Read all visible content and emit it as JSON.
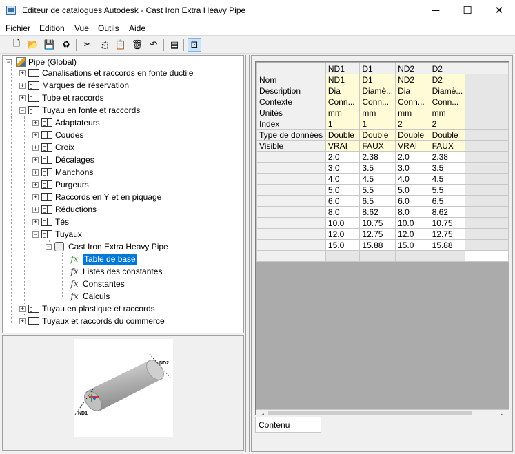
{
  "window": {
    "title": "Editeur de catalogues Autodesk - Cast Iron Extra Heavy Pipe",
    "minimize": "─",
    "maximize": "☐",
    "close": "✕"
  },
  "menu": [
    {
      "label": "Fichier"
    },
    {
      "label": "Edition"
    },
    {
      "label": "Vue"
    },
    {
      "label": "Outils"
    },
    {
      "label": "Aide"
    }
  ],
  "toolbar": {
    "icons": [
      "new-file-icon",
      "open-folder-icon",
      "save-icon",
      "recycle-icon",
      "cut-icon",
      "copy-icon",
      "paste-icon",
      "delete-icon",
      "undo-icon",
      "properties-icon",
      "preview-icon"
    ],
    "glyphs": [
      "🗋",
      "📂",
      "💾",
      "♻",
      "✂",
      "⎘",
      "📋",
      "🗑",
      "↶",
      "▤",
      "⊡"
    ]
  },
  "tree": {
    "root": "Pipe (Global)",
    "level1": [
      "Canalisations et raccords en fonte ductile",
      "Marques de réservation",
      "Tube et raccords",
      "Tuyau en fonte et raccords"
    ],
    "level2": [
      "Adaptateurs",
      "Coudes",
      "Croix",
      "Décalages",
      "Manchons",
      "Purgeurs",
      "Raccords en Y et en piquage",
      "Réductions",
      "Tés",
      "Tuyaux"
    ],
    "pipe_item": "Cast Iron Extra Heavy Pipe",
    "fx_glyph": "fx",
    "level4": [
      "Table de base",
      "Listes des constantes",
      "Constantes",
      "Calculs"
    ],
    "level1_after": [
      "Tuyau en plastique et raccords",
      "Tuyaux et raccords du commerce"
    ]
  },
  "preview": {
    "label_nd1": "ND1",
    "label_nd2": "ND2"
  },
  "grid": {
    "columns": [
      "ND1",
      "D1",
      "ND2",
      "D2"
    ],
    "meta_rows": [
      {
        "label": "Nom",
        "values": [
          "ND1",
          "D1",
          "ND2",
          "D2"
        ]
      },
      {
        "label": "Description",
        "values": [
          "Dia",
          "Diamè...",
          "Dia",
          "Diamè..."
        ]
      },
      {
        "label": "Contexte",
        "values": [
          "Conn...",
          "Conn...",
          "Conn...",
          "Conn..."
        ]
      },
      {
        "label": "Unités",
        "values": [
          "mm",
          "mm",
          "mm",
          "mm"
        ]
      },
      {
        "label": "Index",
        "values": [
          "1",
          "1",
          "2",
          "2"
        ]
      },
      {
        "label": "Type de données",
        "values": [
          "Double",
          "Double",
          "Double",
          "Double"
        ]
      },
      {
        "label": "Visible",
        "values": [
          "VRAI",
          "FAUX",
          "VRAI",
          "FAUX"
        ]
      }
    ],
    "data_rows": [
      [
        "2.0",
        "2.38",
        "2.0",
        "2.38"
      ],
      [
        "3.0",
        "3.5",
        "3.0",
        "3.5"
      ],
      [
        "4.0",
        "4.5",
        "4.0",
        "4.5"
      ],
      [
        "5.0",
        "5.5",
        "5.0",
        "5.5"
      ],
      [
        "6.0",
        "6.5",
        "6.0",
        "6.5"
      ],
      [
        "8.0",
        "8.62",
        "8.0",
        "8.62"
      ],
      [
        "10.0",
        "10.75",
        "10.0",
        "10.75"
      ],
      [
        "12.0",
        "12.75",
        "12.0",
        "12.75"
      ],
      [
        "15.0",
        "15.88",
        "15.0",
        "15.88"
      ]
    ]
  },
  "scroll": {
    "left_arrow": "◀",
    "right_arrow": "▶"
  },
  "tab": {
    "label": "Contenu"
  }
}
